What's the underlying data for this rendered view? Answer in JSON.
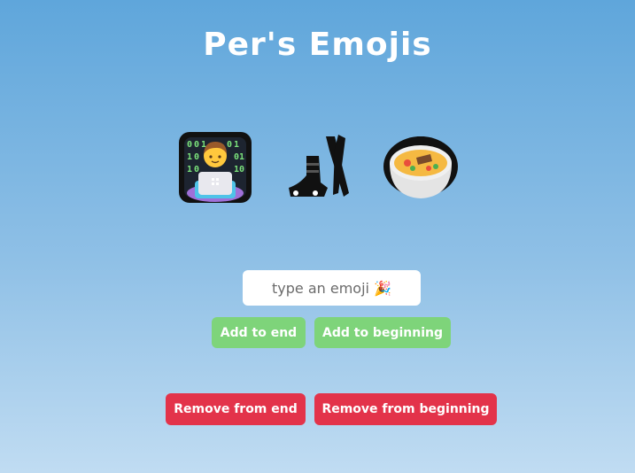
{
  "header": {
    "title": "Per's Emojis"
  },
  "emojis": [
    {
      "icon": "man-technologist-icon",
      "char": "👨‍💻"
    },
    {
      "icon": "skis-icon",
      "char": "🎿"
    },
    {
      "icon": "pot-of-food-icon",
      "char": "🍲"
    }
  ],
  "input": {
    "value": "",
    "placeholder": "type an emoji 🎉"
  },
  "buttons": {
    "add_end": "Add to end",
    "add_beginning": "Add to beginning",
    "remove_end": "Remove from end",
    "remove_beginning": "Remove from beginning"
  },
  "colors": {
    "add": "#7ed47a",
    "remove": "#e3334a",
    "background_top": "#5fa6db",
    "background_bottom": "#c0dcf2"
  }
}
